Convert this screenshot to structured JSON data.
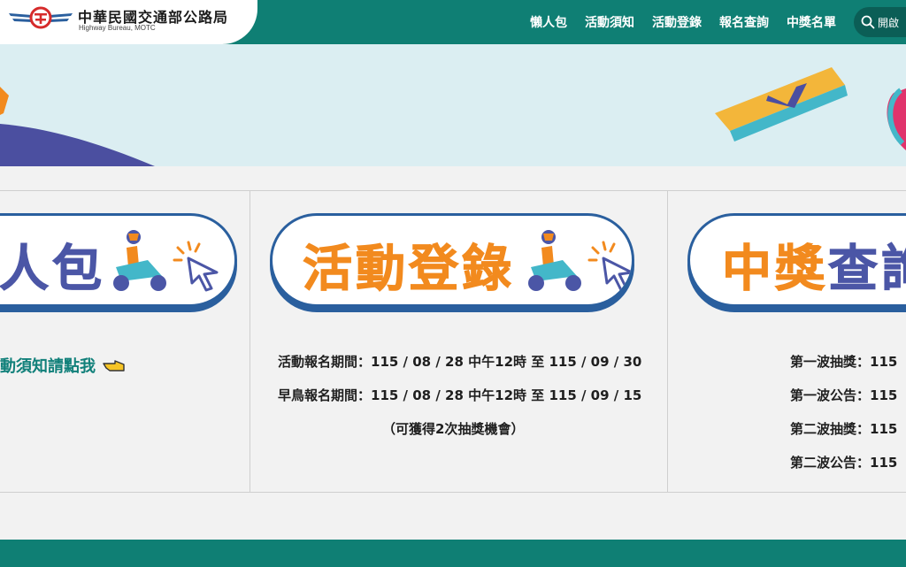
{
  "header": {
    "org_name": "中華民國交通部公路局",
    "org_sub": "Highway Bureau, MOTC",
    "nav": [
      "懶人包",
      "活動須知",
      "活動登錄",
      "報名查詢",
      "中獎名單"
    ],
    "search_label": "開啟"
  },
  "cards": {
    "left": {
      "title_tail": "人包",
      "link": "動須知請點我"
    },
    "middle": {
      "title": "活動登錄",
      "lines": [
        "活動報名期間：115 / 08 / 28 中午12時 至 115 / 09 / 30",
        "早鳥報名期間：115 / 08 / 28 中午12時 至 115 / 09 / 15",
        "（可獲得2次抽獎機會）"
      ]
    },
    "right": {
      "title_orange": "中獎",
      "title_blue": "查詢",
      "lines": [
        "第一波抽獎：115",
        "第一波公告：115",
        "第二波抽獎：115",
        "第二波公告：115"
      ]
    }
  },
  "colors": {
    "brand": "#0f7f74",
    "orange": "#f28a1e",
    "indigo": "#4b56a6",
    "border_blue": "#2a5f9e"
  }
}
